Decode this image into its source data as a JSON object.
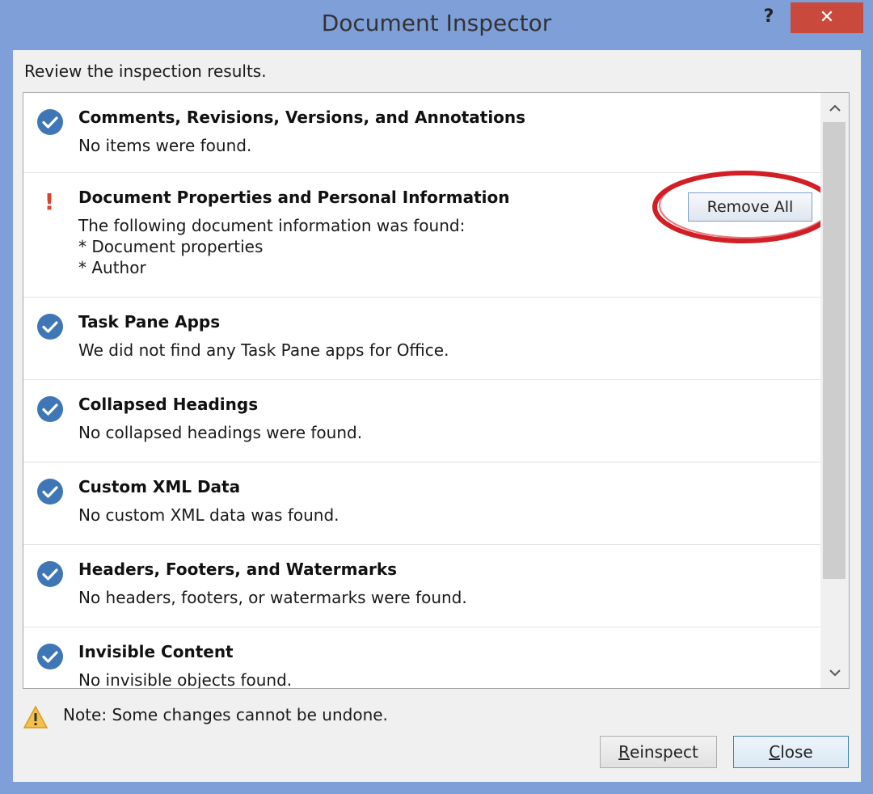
{
  "window": {
    "title": "Document Inspector",
    "help_label": "?",
    "close_label": "✕"
  },
  "instructions": "Review the inspection results.",
  "results": [
    {
      "status": "ok",
      "heading": "Comments, Revisions, Versions, and Annotations",
      "details": [
        "No items were found."
      ]
    },
    {
      "status": "warning",
      "heading": "Document Properties and Personal Information",
      "details": [
        "The following document information was found:",
        "* Document properties",
        "* Author"
      ],
      "action_label": "Remove All"
    },
    {
      "status": "ok",
      "heading": "Task Pane Apps",
      "details": [
        "We did not find any Task Pane apps for Office."
      ]
    },
    {
      "status": "ok",
      "heading": "Collapsed Headings",
      "details": [
        "No collapsed headings were found."
      ]
    },
    {
      "status": "ok",
      "heading": "Custom XML Data",
      "details": [
        "No custom XML data was found."
      ]
    },
    {
      "status": "ok",
      "heading": "Headers, Footers, and Watermarks",
      "details": [
        "No headers, footers, or watermarks were found."
      ]
    },
    {
      "status": "ok",
      "heading": "Invisible Content",
      "details": [
        "No invisible objects found."
      ]
    }
  ],
  "note": "Note: Some changes cannot be undone.",
  "buttons": {
    "reinspect": {
      "mnemonic": "R",
      "rest": "einspect"
    },
    "close": {
      "mnemonic": "C",
      "rest": "lose"
    }
  },
  "colors": {
    "frame": "#7f9fd9",
    "check": "#3f77b6",
    "warning": "#d9442f",
    "highlight_ring": "#d21f26"
  }
}
